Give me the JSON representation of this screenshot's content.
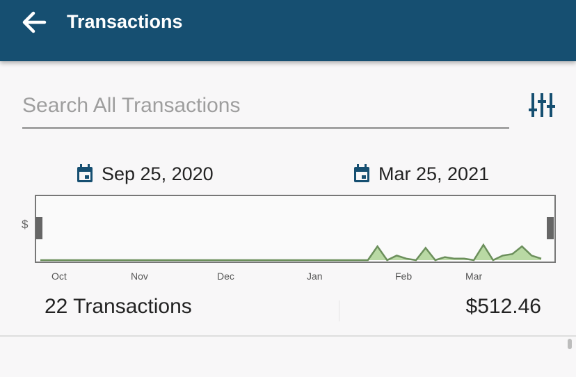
{
  "appbar": {
    "title": "Transactions",
    "back_icon": "arrow-back-icon"
  },
  "search": {
    "placeholder": "Search All Transactions",
    "value": ""
  },
  "filter": {
    "icon": "sliders-icon"
  },
  "date_range": {
    "start": "Sep 25, 2020",
    "end": "Mar 25, 2021"
  },
  "colors": {
    "primary": "#164f71",
    "chart_fill": "#b9d9a4",
    "chart_line": "#6b8f5b"
  },
  "chart": {
    "y_label": "$",
    "months": [
      "Oct",
      "Nov",
      "Dec",
      "Jan",
      "Feb",
      "Mar"
    ]
  },
  "chart_data": {
    "type": "area",
    "x_labels": [
      "Oct",
      "Nov",
      "Dec",
      "Jan",
      "Feb",
      "Mar"
    ],
    "series": [
      {
        "values": [
          0,
          0,
          0,
          0,
          0,
          0,
          0,
          0,
          0,
          0,
          0,
          0,
          0,
          0,
          0,
          0,
          0,
          0,
          0,
          0,
          0,
          0,
          0,
          0,
          0,
          0,
          0,
          0,
          0,
          0,
          0,
          0,
          0,
          0,
          0,
          9,
          0,
          3,
          1,
          0,
          8,
          0,
          2,
          1,
          1,
          0,
          10,
          0,
          3,
          4,
          9,
          3,
          1
        ]
      }
    ]
  },
  "summary": {
    "count": "22 Transactions",
    "total": "$512.46"
  }
}
